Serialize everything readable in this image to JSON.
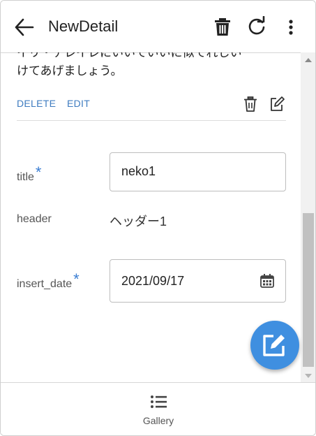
{
  "appbar": {
    "title": "NewDetail",
    "icons": [
      "back-arrow-icon",
      "trash-icon",
      "refresh-icon",
      "more-vert-icon"
    ]
  },
  "content": {
    "partial_text_line1": "イリ・テレイレにいいていいに似てれしい",
    "partial_text_line2": "けてあげましょう。",
    "delete_label": "DELETE",
    "edit_label": "EDIT",
    "fields": {
      "title": {
        "label": "title",
        "required_mark": "*",
        "value": "neko1"
      },
      "header": {
        "label": "header",
        "value": "ヘッダー1"
      },
      "insert_date": {
        "label": "insert_date",
        "required_mark": "*",
        "value": "2021/09/17"
      }
    }
  },
  "bottom_nav": {
    "gallery_label": "Gallery"
  },
  "colors": {
    "accent": "#3f7cc0",
    "fab": "#3f8fe0",
    "required": "#3a7dd2"
  }
}
